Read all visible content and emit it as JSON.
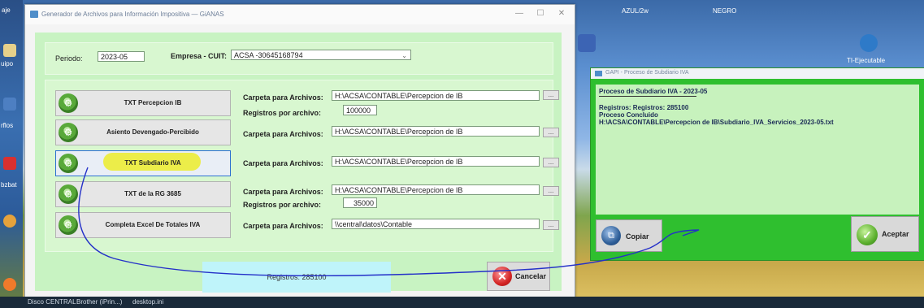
{
  "desktop": {
    "left_labels": [
      "aje",
      "uipo",
      "rflos",
      "bzbat"
    ],
    "top_labels": [
      "AZUL/2w",
      "NEGRO"
    ],
    "right_icon_label": "TI-Ejecutable",
    "taskbar_items": [
      "Disco CENTRAL",
      "Brother (iPrin...)",
      "desktop.ini"
    ]
  },
  "main_window": {
    "title": "Generador de Archivos para Información Impositiva  —  GiANAS",
    "controls": {
      "minimize": "—",
      "maximize": "☐",
      "close": "✕"
    },
    "periodo_label": "Periodo:",
    "periodo_value": "2023-05",
    "empresa_label": "Empresa - CUIT:",
    "empresa_value": "ACSA  -30645168794",
    "rows": [
      {
        "button": "TXT Percepcion IB",
        "carpeta_label": "Carpeta para Archivos:",
        "carpeta_value": "H:\\ACSA\\CONTABLE\\Percepcion de IB",
        "registros_label": "Registros por archivo:",
        "registros_value": "100000"
      },
      {
        "button": "Asiento Devengado-Percibido",
        "carpeta_label": "Carpeta para Archivos:",
        "carpeta_value": "H:\\ACSA\\CONTABLE\\Percepcion de IB"
      },
      {
        "button": "TXT Subdiario IVA",
        "carpeta_label": "Carpeta para Archivos:",
        "carpeta_value": "H:\\ACSA\\CONTABLE\\Percepcion de IB"
      },
      {
        "button": "TXT de la RG 3685",
        "carpeta_label": "Carpeta para Archivos:",
        "carpeta_value": "H:\\ACSA\\CONTABLE\\Percepcion de IB",
        "registros_label": "Registros por archivo:",
        "registros_value": "35000"
      },
      {
        "button": "Completa Excel De Totales IVA",
        "carpeta_label": "Carpeta para Archivos:",
        "carpeta_value": "\\\\central\\datos\\Contable"
      }
    ],
    "browse_label": "...",
    "status_text": "Registros: 285100",
    "cancel_label": "Cancelar"
  },
  "result_window": {
    "title": "GAPI - Proceso de Subdiario IVA",
    "log_heading": "Proceso de Subdiario IVA - 2023-05",
    "log_lines": [
      "Registros: Registros: 285100",
      "Proceso Concluido",
      "H:\\ACSA\\CONTABLE\\Percepcion de IB\\Subdiario_IVA_Servicios_2023-05.txt"
    ],
    "copy_label": "Copiar",
    "accept_label": "Aceptar"
  },
  "colors": {
    "client_bg": "#c8f3c2",
    "result_window_bg": "#2fbf2f",
    "status_bg": "#bff4fa",
    "highlight": "#ecec2a",
    "annotation_line": "#2430c8"
  }
}
